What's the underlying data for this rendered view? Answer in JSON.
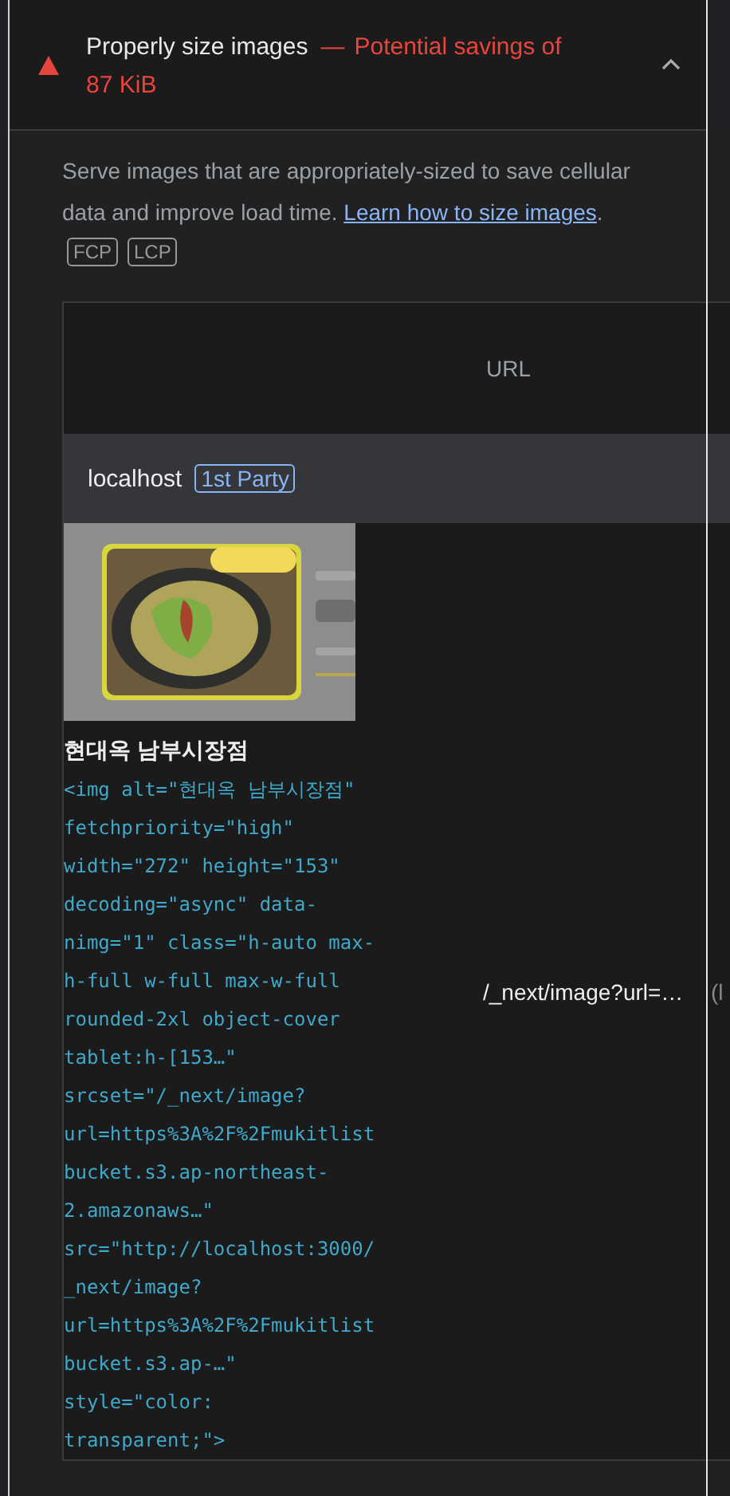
{
  "audit": {
    "failed": true,
    "title": "Properly size images",
    "separator": "—",
    "display_value": "Potential savings of 87 KiB",
    "expanded": true,
    "description": {
      "before": "Serve images that are appropriately-sized to save cellular data and improve load time. ",
      "link": "Learn how to size images",
      "after": "."
    },
    "metrics": [
      "FCP",
      "LCP"
    ],
    "table": {
      "columns": [
        "URL"
      ],
      "groups": [
        {
          "entity": "localhost",
          "badge": "1st Party",
          "rows": [
            {
              "node_label": "현대옥 남부시장점",
              "snippet_lines": [
                "<img alt=\"현대옥 남부시장점\"",
                "fetchpriority=\"high\"",
                "width=\"272\" height=\"153\"",
                "decoding=\"async\" data-",
                "nimg=\"1\" class=\"h-auto max-",
                "h-full w-full max-w-full",
                "rounded-2xl object-cover",
                "tablet:h-[153…\"",
                "srcset=\"/_next/image?",
                "url=https%3A%2F%2Fmukitlist",
                "bucket.s3.ap-northeast-",
                "2.amazonaws…\"",
                "src=\"http://localhost:3000/",
                "_next/image?",
                "url=https%3A%2F%2Fmukitlist",
                "bucket.s3.ap-…\"",
                "style=\"color:",
                "transparent;\">"
              ],
              "url": "/_next/image?url=…",
              "column_2": "(l"
            }
          ]
        }
      ]
    }
  }
}
